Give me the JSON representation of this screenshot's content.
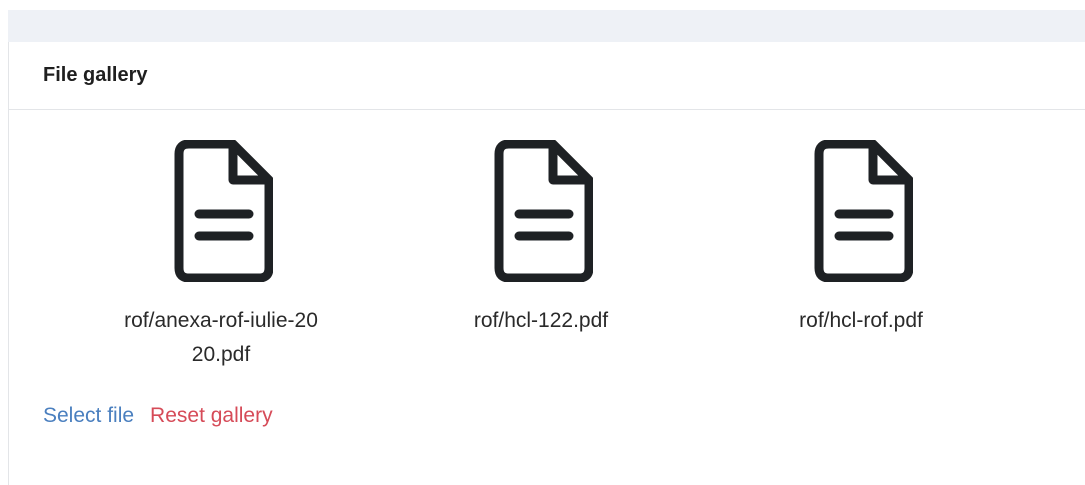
{
  "panel": {
    "title": "File gallery"
  },
  "files": [
    {
      "name": "rof/anexa-rof-iulie-2020.pdf",
      "icon": "file-text-icon"
    },
    {
      "name": "rof/hcl-122.pdf",
      "icon": "file-text-icon"
    },
    {
      "name": "rof/hcl-rof.pdf",
      "icon": "file-text-icon"
    }
  ],
  "actions": {
    "select_label": "Select file",
    "reset_label": "Reset gallery"
  },
  "colors": {
    "select_link": "#4a7fbf",
    "reset_link": "#d64b58",
    "icon_stroke": "#1e2124",
    "top_strip": "#eef1f6"
  }
}
